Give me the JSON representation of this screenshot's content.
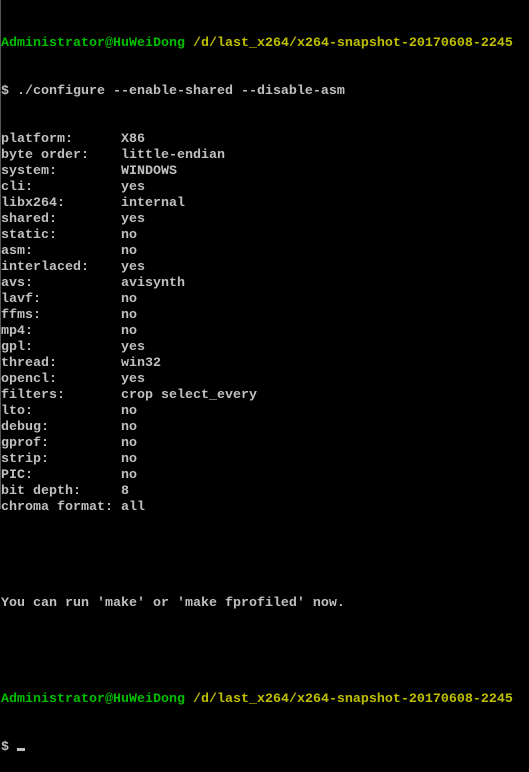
{
  "prompt1": {
    "user": "Administrator@HuWeiDong",
    "path": "/d/last_x264/x264-snapshot-20170608-2245"
  },
  "command": "$ ./configure --enable-shared --disable-asm",
  "config": [
    {
      "key": "platform:",
      "value": "X86"
    },
    {
      "key": "byte order:",
      "value": "little-endian"
    },
    {
      "key": "system:",
      "value": "WINDOWS"
    },
    {
      "key": "cli:",
      "value": "yes"
    },
    {
      "key": "libx264:",
      "value": "internal"
    },
    {
      "key": "shared:",
      "value": "yes"
    },
    {
      "key": "static:",
      "value": "no"
    },
    {
      "key": "asm:",
      "value": "no"
    },
    {
      "key": "interlaced:",
      "value": "yes"
    },
    {
      "key": "avs:",
      "value": "avisynth"
    },
    {
      "key": "lavf:",
      "value": "no"
    },
    {
      "key": "ffms:",
      "value": "no"
    },
    {
      "key": "mp4:",
      "value": "no"
    },
    {
      "key": "gpl:",
      "value": "yes"
    },
    {
      "key": "thread:",
      "value": "win32"
    },
    {
      "key": "opencl:",
      "value": "yes"
    },
    {
      "key": "filters:",
      "value": "crop select_every"
    },
    {
      "key": "lto:",
      "value": "no"
    },
    {
      "key": "debug:",
      "value": "no"
    },
    {
      "key": "gprof:",
      "value": "no"
    },
    {
      "key": "strip:",
      "value": "no"
    },
    {
      "key": "PIC:",
      "value": "no"
    },
    {
      "key": "bit depth:",
      "value": "8"
    },
    {
      "key": "chroma format:",
      "value": "all"
    }
  ],
  "message": "You can run 'make' or 'make fprofiled' now.",
  "prompt2": {
    "user": "Administrator@HuWeiDong",
    "path": "/d/last_x264/x264-snapshot-20170608-2245"
  },
  "input_prompt": "$ ",
  "colors": {
    "user": "#00bf00",
    "path": "#bfbf00",
    "text": "#c0c0c0",
    "background": "#000000"
  }
}
